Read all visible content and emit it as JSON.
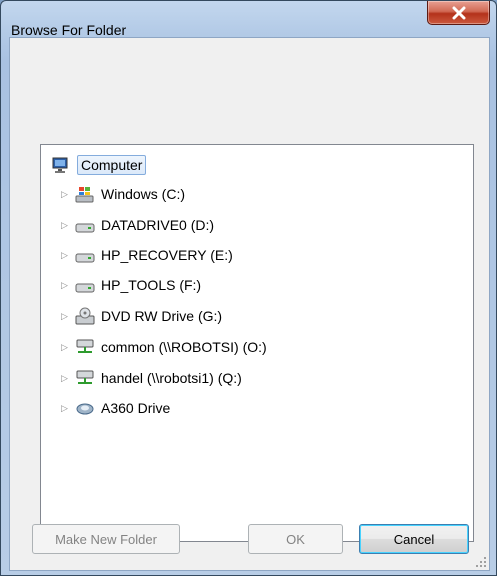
{
  "window": {
    "title": "Browse For Folder",
    "close_icon": "close-icon"
  },
  "tree": {
    "items": [
      {
        "label": "Computer",
        "icon": "computer-icon",
        "selected": true
      },
      {
        "label": "Windows (C:)",
        "icon": "windows-drive-icon"
      },
      {
        "label": "DATADRIVE0 (D:)",
        "icon": "hard-drive-icon"
      },
      {
        "label": "HP_RECOVERY (E:)",
        "icon": "hard-drive-icon"
      },
      {
        "label": "HP_TOOLS (F:)",
        "icon": "hard-drive-icon"
      },
      {
        "label": "DVD RW Drive (G:)",
        "icon": "dvd-drive-icon"
      },
      {
        "label": "common (\\\\ROBOTSI) (O:)",
        "icon": "network-drive-icon"
      },
      {
        "label": "handel (\\\\robotsi1) (Q:)",
        "icon": "network-drive-icon"
      },
      {
        "label": "A360 Drive",
        "icon": "cloud-drive-icon"
      }
    ]
  },
  "buttons": {
    "make_new_folder": "Make New Folder",
    "ok": "OK",
    "cancel": "Cancel"
  },
  "colors": {
    "accent": "#3c7fb1",
    "close": "#c7422a"
  }
}
